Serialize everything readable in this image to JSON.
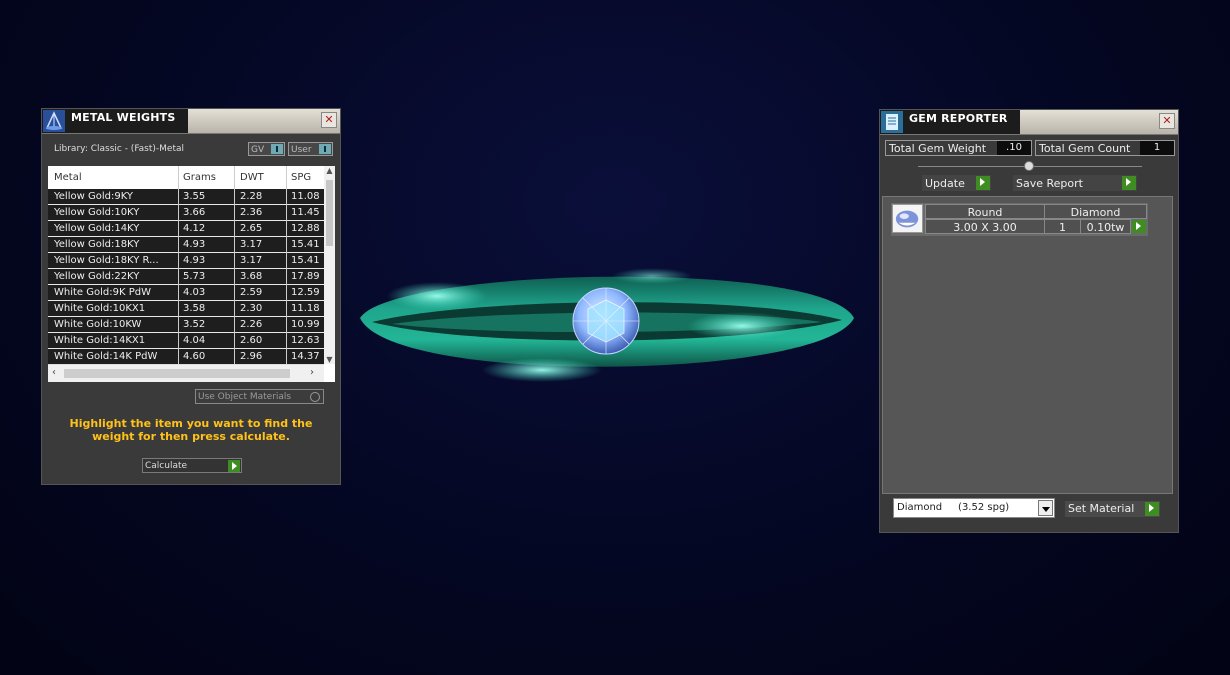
{
  "metal_weights": {
    "title": "METAL WEIGHTS",
    "close": "✕",
    "library_label": "Library: Classic - (Fast)-Metal",
    "toggle_gv": "GV",
    "toggle_user": "User",
    "columns": [
      "Metal",
      "Grams",
      "DWT",
      "SPG"
    ],
    "rows": [
      {
        "metal": "Yellow Gold:9KY",
        "grams": "3.55",
        "dwt": "2.28",
        "spg": "11.08"
      },
      {
        "metal": "Yellow Gold:10KY",
        "grams": "3.66",
        "dwt": "2.36",
        "spg": "11.45"
      },
      {
        "metal": "Yellow Gold:14KY",
        "grams": "4.12",
        "dwt": "2.65",
        "spg": "12.88"
      },
      {
        "metal": "Yellow Gold:18KY",
        "grams": "4.93",
        "dwt": "3.17",
        "spg": "15.41"
      },
      {
        "metal": "Yellow Gold:18KY R...",
        "grams": "4.93",
        "dwt": "3.17",
        "spg": "15.41"
      },
      {
        "metal": "Yellow Gold:22KY",
        "grams": "5.73",
        "dwt": "3.68",
        "spg": "17.89"
      },
      {
        "metal": "White Gold:9K PdW",
        "grams": "4.03",
        "dwt": "2.59",
        "spg": "12.59"
      },
      {
        "metal": "White Gold:10KX1",
        "grams": "3.58",
        "dwt": "2.30",
        "spg": "11.18"
      },
      {
        "metal": "White Gold:10KW",
        "grams": "3.52",
        "dwt": "2.26",
        "spg": "10.99"
      },
      {
        "metal": "White Gold:14KX1",
        "grams": "4.04",
        "dwt": "2.60",
        "spg": "12.63"
      },
      {
        "metal": "White Gold:14K PdW",
        "grams": "4.60",
        "dwt": "2.96",
        "spg": "14.37"
      }
    ],
    "use_object_materials": "Use Object Materials",
    "hint": "Highlight the item you want to find the weight for then press calculate.",
    "calculate": "Calculate"
  },
  "gem_reporter": {
    "title": "GEM REPORTER",
    "close": "✕",
    "total_gem_weight_label": "Total Gem Weight",
    "total_gem_weight_value": ".10",
    "total_gem_count_label": "Total Gem Count",
    "total_gem_count_value": "1",
    "update": "Update",
    "save_report": "Save Report",
    "gem": {
      "shape": "Round",
      "material": "Diamond",
      "size": "3.00 X 3.00",
      "count": "1",
      "weight": "0.10tw"
    },
    "material_select": "Diamond     (3.52 spg)",
    "set_material": "Set Material"
  },
  "colors": {
    "ring": "#1fa58c",
    "gem": "#8fb8ff",
    "accent_go": "#3f8d22",
    "hint": "#ffc21a"
  }
}
